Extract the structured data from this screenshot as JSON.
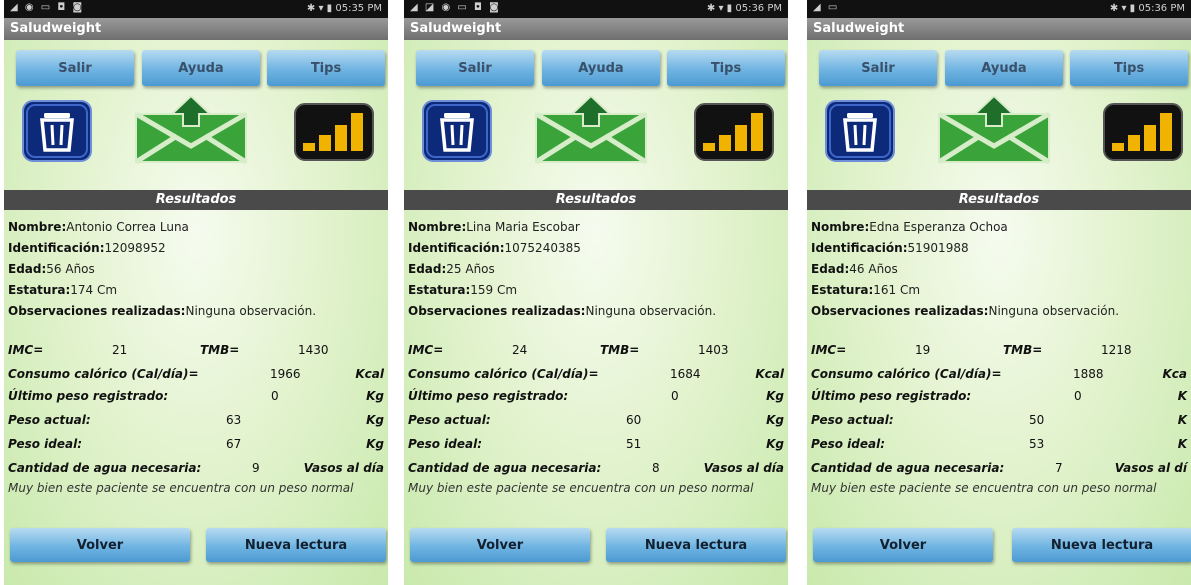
{
  "app_title": "Saludweight",
  "buttons": {
    "salir": "Salir",
    "ayuda": "Ayuda",
    "tips": "Tips",
    "volver": "Volver",
    "nueva_lectura": "Nueva lectura"
  },
  "results_header": "Resultados",
  "labels": {
    "nombre": "Nombre:",
    "identificacion": "Identificación:",
    "edad": "Edad:",
    "estatura": "Estatura:",
    "observaciones": "Observaciones realizadas:",
    "imc": "IMC=",
    "tmb": "TMB=",
    "consumo": "Consumo calórico (Cal/día)=",
    "ultimo_peso": "Último peso registrado:",
    "peso_actual": "Peso actual:",
    "peso_ideal": "Peso ideal:",
    "agua": "Cantidad de agua necesaria:"
  },
  "colors": {
    "button_blue": "#6fb4e2",
    "header_gray": "#4a4a4a",
    "background_green": "#d4eebd"
  },
  "icons": [
    "trash-icon",
    "send-mail-icon",
    "signal-bars-icon"
  ],
  "screens": [
    {
      "status_time": "05:35 PM",
      "nombre": "Antonio Correa Luna",
      "identificacion": "12098952",
      "edad": "56 Años",
      "estatura": "174 Cm",
      "observaciones": "Ninguna observación.",
      "imc": "21",
      "tmb": "1430",
      "consumo": "1966",
      "consumo_unit": "Kcal",
      "ultimo_peso": "0",
      "ultimo_peso_unit": "Kg",
      "peso_actual": "63",
      "peso_actual_unit": "Kg",
      "peso_ideal": "67",
      "peso_ideal_unit": "Kg",
      "agua": "9",
      "agua_unit": "Vasos al día",
      "mensaje": "Muy bien este paciente se encuentra con un peso normal"
    },
    {
      "status_time": "05:36 PM",
      "nombre": "Lina Maria Escobar",
      "identificacion": "1075240385",
      "edad": "25 Años",
      "estatura": "159 Cm",
      "observaciones": "Ninguna observación.",
      "imc": "24",
      "tmb": "1403",
      "consumo": "1684",
      "consumo_unit": "Kcal",
      "ultimo_peso": "0",
      "ultimo_peso_unit": "Kg",
      "peso_actual": "60",
      "peso_actual_unit": "Kg",
      "peso_ideal": "51",
      "peso_ideal_unit": "Kg",
      "agua": "8",
      "agua_unit": "Vasos al día",
      "mensaje": "Muy bien este paciente se encuentra con un peso normal"
    },
    {
      "status_time": "05:36 PM",
      "nombre": "Edna Esperanza Ochoa",
      "identificacion": "51901988",
      "edad": "46 Años",
      "estatura": "161 Cm",
      "observaciones": "Ninguna observación.",
      "imc": "19",
      "tmb": "1218",
      "consumo": "1888",
      "consumo_unit": "Kca",
      "ultimo_peso": "0",
      "ultimo_peso_unit": "K",
      "peso_actual": "50",
      "peso_actual_unit": "K",
      "peso_ideal": "53",
      "peso_ideal_unit": "K",
      "agua": "7",
      "agua_unit": "Vasos al dí",
      "mensaje": "Muy bien este paciente se encuentra con un peso normal"
    }
  ]
}
